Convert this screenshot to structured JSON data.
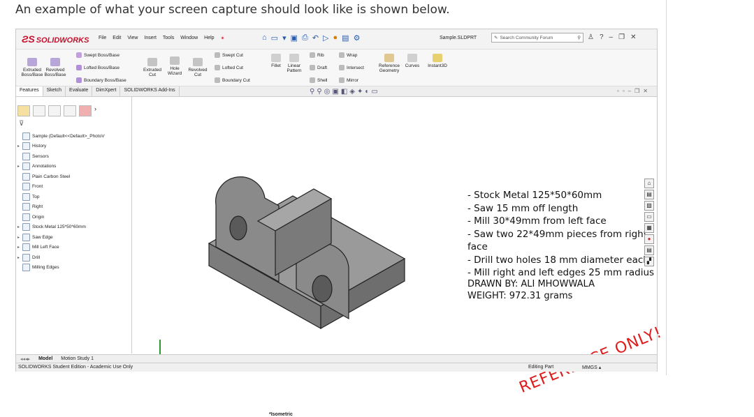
{
  "caption": "An example of what your screen capture should look like is shown below.",
  "app": {
    "brand": "SOLIDWORKS",
    "menu": [
      "File",
      "Edit",
      "View",
      "Insert",
      "Tools",
      "Window",
      "Help"
    ],
    "doc_title": "Sample.SLDPRT",
    "search_placeholder": "Search Community Forum"
  },
  "ribbon": {
    "extruded_boss": "Extruded Boss/Base",
    "revolved_boss": "Revolved Boss/Base",
    "swept_boss": "Swept Boss/Base",
    "lofted_boss": "Lofted Boss/Base",
    "boundary_boss": "Boundary Boss/Base",
    "extruded_cut": "Extruded Cut",
    "hole_wizard": "Hole Wizard",
    "revolved_cut": "Revolved Cut",
    "swept_cut": "Swept Cut",
    "lofted_cut": "Lofted Cut",
    "boundary_cut": "Boundary Cut",
    "fillet": "Fillet",
    "linear_pattern": "Linear Pattern",
    "rib": "Rib",
    "wrap": "Wrap",
    "draft": "Draft",
    "intersect": "Intersect",
    "shell": "Shell",
    "mirror": "Mirror",
    "reference_geometry": "Reference Geometry",
    "curves": "Curves",
    "instant3d": "Instant3D"
  },
  "tabs": [
    "Features",
    "Sketch",
    "Evaluate",
    "DimXpert",
    "SOLIDWORKS Add-Ins"
  ],
  "tree": [
    {
      "label": "Sample  (Default<<Default>_PhotoV",
      "arrow": ""
    },
    {
      "label": "History",
      "arrow": "▸"
    },
    {
      "label": "Sensors",
      "arrow": ""
    },
    {
      "label": "Annotations",
      "arrow": "▸"
    },
    {
      "label": "Plain Carbon Steel",
      "arrow": ""
    },
    {
      "label": "Front",
      "arrow": ""
    },
    {
      "label": "Top",
      "arrow": ""
    },
    {
      "label": "Right",
      "arrow": ""
    },
    {
      "label": "Origin",
      "arrow": ""
    },
    {
      "label": "Stock Metal 125*50*60mm",
      "arrow": "▸"
    },
    {
      "label": "Saw Edge",
      "arrow": "▸"
    },
    {
      "label": "Mill Left Face",
      "arrow": "▸"
    },
    {
      "label": "Drill",
      "arrow": "▸"
    },
    {
      "label": "Milling Edges",
      "arrow": ""
    }
  ],
  "notes": [
    "- Stock Metal 125*50*60mm",
    "- Saw 15 mm off length",
    "- Mill 30*49mm from left face",
    "- Saw two 22*49mm pieces from right face",
    "- Drill two holes 18 mm diameter each",
    "- Mill right and left edges 25 mm radius"
  ],
  "drawn_by": "DRAWN BY: ALI MHOWWALA",
  "weight": "WEIGHT: 972.31 grams",
  "stamp": "REFERENCE ONLY!",
  "view_label": "*Isometric",
  "bottom_tabs": [
    "Model",
    "Motion Study 1"
  ],
  "status": {
    "left": "SOLIDWORKS Student Edition - Academic Use Only",
    "mode": "Editing Part",
    "units": "MMGS"
  },
  "colors": {
    "brand": "#c8102e",
    "stamp": "#e01b1b",
    "part": "#8c8c8c"
  }
}
